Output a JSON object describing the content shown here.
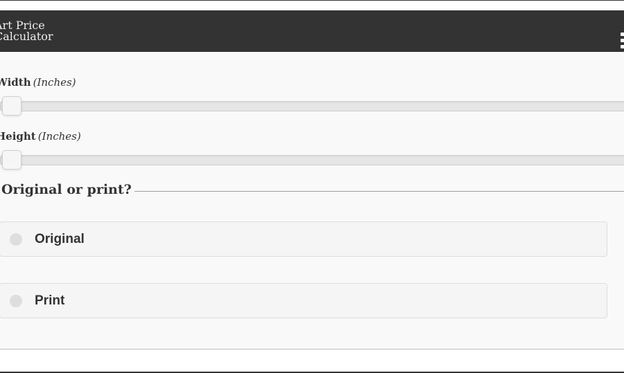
{
  "header": {
    "title_line1": "Art Price",
    "title_line2": "Calculator"
  },
  "sliders": [
    {
      "label_bold": "Width",
      "label_unit": "(Inches)",
      "value": 0.0
    },
    {
      "label_bold": "Height",
      "label_unit": "(Inches)",
      "value": 0.0
    }
  ],
  "type_group": {
    "legend": "Original or print?",
    "options": [
      {
        "label": "Original",
        "selected": false
      },
      {
        "label": "Print",
        "selected": false
      }
    ]
  },
  "icons": {
    "menu": "hamburger-menu-icon"
  },
  "colors": {
    "header_bg": "#333333",
    "content_bg": "#f9f9f9"
  }
}
